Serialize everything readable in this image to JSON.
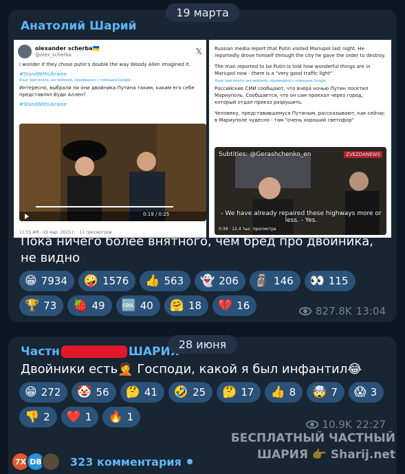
{
  "post1": {
    "date": "19 марта",
    "author": "Анатолий Шарий",
    "tweet1": {
      "name": "olexander scherba🇺🇦",
      "handle": "@olex_scherba",
      "text_en": "I wonder if they chose putin's double the way Woody Allen imagined it.",
      "hashtag1": "#StandWithUkraine",
      "translation_note": "Язык оригинала: английский, переведено с помощью Google",
      "text_ru": "Интересно, выбрали ли они двойника Путина таким, каким его себе представлял Вуди Аллен?",
      "hashtag2": "#StandWithUkraine",
      "video_time": "0:19 / 0:25",
      "footer": "11:55 AM · 19 мар. 2023 г. · 11 просмотров"
    },
    "tweet2": {
      "text_en1": "Russian media report that Putin visited Mariupol last night. He reportedly drove himself through the city he gave the order to destroy.",
      "text_en2": "The man reported to be Putin is told how wonderful things are in Mariupol now - there is a \"very good traffic light\"",
      "translation_note": "Язык оригинала: английский, переведено с помощью Google",
      "text_ru1": "Российские СМИ сообщают, что вчера ночью Путин посетил Мариуполь. Сообщается, что он сам проехал через город, который отдал приказ разрушить.",
      "text_ru2": "Человеку, представившемуся Путиным, рассказывают, как сейчас в Мариуполе чудесно - там \"очень хороший светофор\"",
      "subtitles": "Subtitles: @Gerashchenko_en",
      "badge": "ZVEZDANEWS",
      "caption": "- We have already repaired these highways more or less. - Yes.",
      "video_meta": "0:39 · 12,4 тыс. просмотра"
    },
    "text": "Пока ничего более внятного, чем бред про двойника, не видно",
    "reactions": [
      {
        "emoji": "😁",
        "count": "7934"
      },
      {
        "emoji": "🤪",
        "count": "1576"
      },
      {
        "emoji": "👍",
        "count": "563"
      },
      {
        "emoji": "👻",
        "count": "206"
      },
      {
        "emoji": "🗿",
        "count": "146"
      },
      {
        "emoji": "👀",
        "count": "115"
      },
      {
        "emoji": "🏆",
        "count": "73"
      },
      {
        "emoji": "🍓",
        "count": "49"
      },
      {
        "emoji": "🆒",
        "count": "40"
      },
      {
        "emoji": "🤗",
        "count": "18"
      },
      {
        "emoji": "💔",
        "count": "16"
      }
    ],
    "views": "827.8K",
    "time": "13:04"
  },
  "post2": {
    "date": "28 июня",
    "author_prefix": "Частн",
    "author_suffix": "ШАРИЯ",
    "text": "Двойники есть🤦 Господи, какой я был инфантил😂",
    "reactions": [
      {
        "emoji": "😁",
        "count": "272"
      },
      {
        "emoji": "🤡",
        "count": "56"
      },
      {
        "emoji": "🤔",
        "count": "41"
      },
      {
        "emoji": "🤣",
        "count": "25"
      },
      {
        "emoji": "🤔",
        "count": "17"
      },
      {
        "emoji": "👍",
        "count": "8"
      },
      {
        "emoji": "🤯",
        "count": "7"
      },
      {
        "emoji": "😱",
        "count": "3"
      },
      {
        "emoji": "👎",
        "count": "2"
      },
      {
        "emoji": "❤️",
        "count": "1"
      },
      {
        "emoji": "🔥",
        "count": "1"
      }
    ],
    "views": "10.9K",
    "time": "22:27",
    "comments_label": "323 комментария",
    "avatars": [
      "7X",
      "DB",
      ""
    ]
  },
  "watermark": {
    "line1": "БЕСПЛАТНЫЙ ЧАСТНЫЙ",
    "line2": "ШАРИЯ 👉 Sharij.net"
  },
  "colors": {
    "bg": "#0e1621",
    "bubble": "#182533",
    "reaction": "#2b5278",
    "link": "#5eb5f7"
  }
}
